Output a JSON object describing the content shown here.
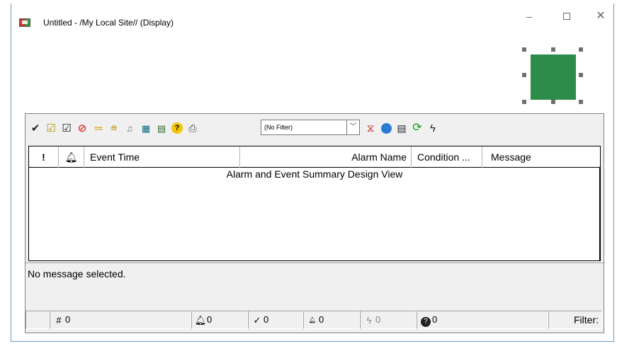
{
  "window": {
    "title": "Untitled - /My Local Site// (Display)",
    "minimize_glyph": "–",
    "close_glyph": "✕"
  },
  "toolbar": {
    "icons": [
      "acknowledge-icon",
      "acknowledge-page-icon",
      "acknowledge-selected-icon",
      "disable-icon",
      "equal-icon",
      "sort-icon",
      "silence-bell-icon",
      "alarm-detail-icon",
      "properties-icon",
      "help-icon",
      "print-icon",
      "clear-filter-icon",
      "find-icon",
      "list-icon",
      "refresh-icon",
      "execute-icon"
    ],
    "filter_value": "(No Filter)"
  },
  "grid": {
    "columns": [
      "!",
      "",
      "Event Time",
      "Alarm Name",
      "Condition ...",
      "Message"
    ],
    "design_view_text": "Alarm and Event Summary Design View"
  },
  "message_panel": {
    "text": "No message selected."
  },
  "statusbar": {
    "total": "0",
    "in_alarm": "0",
    "acknowledged": "0",
    "low": "0",
    "disabled": "0",
    "unknown": "0",
    "filter_label": "Filter:"
  },
  "colors": {
    "selected_object": "#2d8c4a",
    "window_border": "#6f95c9"
  }
}
